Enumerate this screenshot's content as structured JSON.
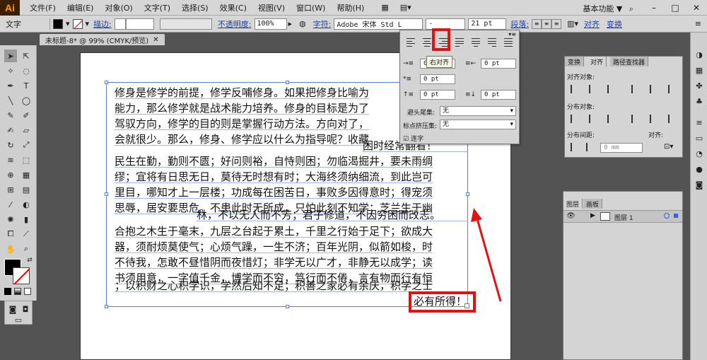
{
  "app": {
    "logo": "Ai",
    "workspace": "基本功能",
    "workspace_caret": "▼",
    "search_icon": "search-icon"
  },
  "menu": [
    "文件(F)",
    "编辑(E)",
    "对象(O)",
    "文字(T)",
    "选择(S)",
    "效果(C)",
    "视图(V)",
    "窗口(W)",
    "帮助(H)"
  ],
  "window_controls": [
    "–",
    "□",
    "✕"
  ],
  "control_bar": {
    "tool_label": "文字",
    "stroke_label": "描边:",
    "opacity_label": "不透明度:",
    "opacity_value": "100%",
    "font_label": "字符:",
    "font_name": "Adobe 宋体 Std L",
    "font_style": "-",
    "font_size": "21 pt",
    "para_label": "段落:",
    "align_label": "对齐",
    "transform_label": "变换"
  },
  "document_tab": {
    "title": "未标题-8* @ 99% (CMYK/预览)",
    "close": "✕"
  },
  "text_lines": [
    "修身是修学的前提，修学反哺修身。如果把修身比喻为",
    "能力，那么修学就是战术能力培养。修身的目标是为了",
    "驾驭方向，修学的目的则是掌握行动方法。方向对了，",
    "会就很少。那么，修身、修学应以什么为指导呢？收藏",
    "困时经常翻看！",
    "民生在勤，勤则不匮；好问则裕，自恃则困；勿临渴掘井，要未雨绸",
    "缪；宜将有日思无日，莫待无时想有时；大海终须纳细流，到此岂可",
    "里目，哪知才上一层楼；功成每在困苦日，事败多因得意时；得宠须",
    "思辱，居安要思危。不患此时无所成，只怕此刻不知学；芝兰生于幽",
    "林，不以无人而不芳；君子修道，不因穷困而改志。",
    "合抱之木生于毫末，九层之台起于累土，千里之行始于足下；欲成大",
    "器，须耐烦莫使气；心烦气躁，一生不济；百年光阴，似箭如梭，时",
    "不待我，怎敢不昼惜阴而夜惜灯；非学无以广才，非静无以成学；读",
    "书须用意，一字值千金，博学而不穷，笃行而不倦，言有物而行有恒",
    "；以积财之心积学识，学然后知不足；积善之家必有余庆，积学之士"
  ],
  "overset_text": "必有所得！",
  "paragraph_panel": {
    "tooltip": "右对齐",
    "left_indent": "0 pt",
    "right_indent": "0 pt",
    "first_indent": "0 pt",
    "space_before": "0 pt",
    "space_after": "0 pt",
    "kinsoku_label": "避头尾集:",
    "kinsoku_value": "无",
    "mojikumi_label": "标点挤压集:",
    "mojikumi_value": "无",
    "hyphen_label": "连字"
  },
  "align_panel": {
    "tabs": [
      "变换",
      "对齐",
      "路径查找器"
    ],
    "align_objects": "对齐对象:",
    "distribute_objects": "分布对象:",
    "distribute_spacing": "分布间距:",
    "align_to": "对齐:",
    "spacing_value": "0 mm"
  },
  "layers_panel": {
    "tabs": [
      "图层",
      "画板"
    ],
    "layer_name": "图层 1"
  },
  "colors": {
    "highlight": "#e11212",
    "selection": "#5d7bd1"
  }
}
